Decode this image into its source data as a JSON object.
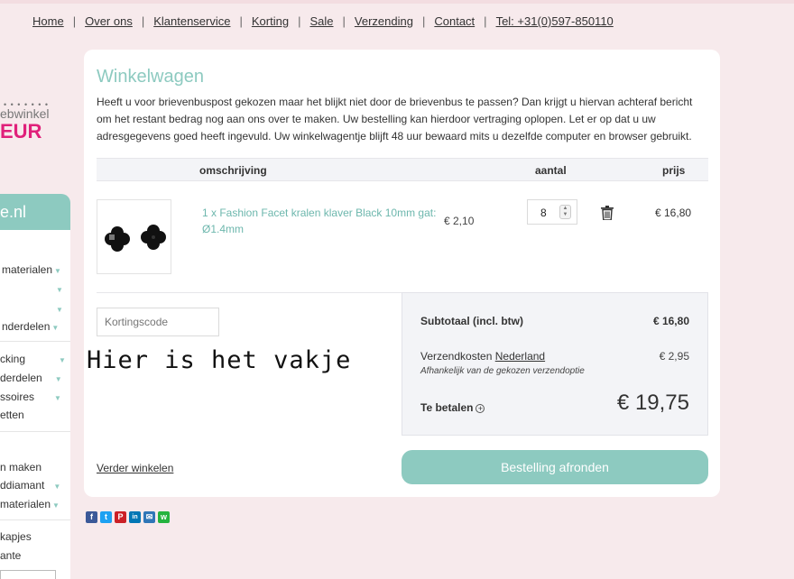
{
  "nav": {
    "items": [
      "Home",
      "Over ons",
      "Klantenservice",
      "Korting",
      "Sale",
      "Verzending",
      "Contact",
      "Tel: +31(0)597-850110"
    ]
  },
  "sidebar": {
    "logo_dots": "• • • • • • •",
    "logo_sub": "ebwinkel",
    "logo_big": "EUR",
    "head": "e.nl",
    "items": [
      "materialen",
      "",
      "",
      "nderdelen",
      "cking",
      "derdelen",
      "ssoires",
      "etten",
      "n maken",
      "ddiamant",
      "materialen",
      "kapjes",
      "ante"
    ]
  },
  "cart": {
    "title": "Winkelwagen",
    "intro": "Heeft u voor brievenbuspost gekozen maar het blijkt niet door de brievenbus te passen? Dan krijgt u hiervan achteraf bericht om het restant bedrag nog aan ons over te maken. Uw bestelling kan hierdoor vertraging oplopen. Let er op dat u uw adresgegevens goed heeft ingevuld. Uw winkelwagentje blijft 48 uur bewaard mits u dezelfde computer en browser gebruikt.",
    "headers": {
      "description": "omschrijving",
      "quantity": "aantal",
      "price": "prijs"
    },
    "item": {
      "name": "1 x Fashion Facet kralen klaver Black 10mm gat: Ø1.4mm",
      "unit_price": "€ 2,10",
      "quantity": "8",
      "price": "€ 16,80"
    },
    "coupon_placeholder": "Kortingscode",
    "summary": {
      "subtotal_label": "Subtotaal (incl. btw)",
      "subtotal_value": "€ 16,80",
      "shipping_label": "Verzendkosten",
      "shipping_country": "Nederland",
      "shipping_note": "Afhankelijk van de gekozen verzendoptie",
      "shipping_value": "€ 2,95",
      "total_label": "Te betalen",
      "total_value": "€ 19,75"
    },
    "continue_label": "Verder winkelen",
    "checkout_label": "Bestelling afronden"
  },
  "annotation": "Hier is het vakje",
  "social": {
    "icons": [
      "facebook-icon",
      "twitter-icon",
      "pinterest-icon",
      "linkedin-icon",
      "email-icon",
      "whatsapp-icon"
    ],
    "glyphs": [
      "f",
      "t",
      "P",
      "in",
      "✉",
      "w"
    ],
    "colors": [
      "#3b5998",
      "#1da1f2",
      "#cb2027",
      "#0077b5",
      "#2f76b7",
      "#25b33f"
    ]
  },
  "colors": {
    "accent": "#8dcac0",
    "brand": "#e0207a",
    "background": "#f7eaec"
  }
}
